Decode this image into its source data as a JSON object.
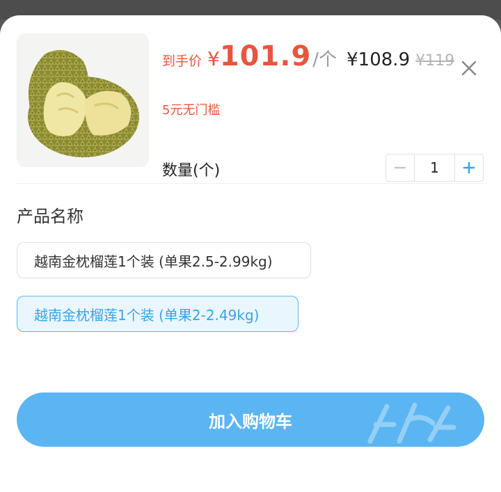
{
  "product": {
    "image_icon": "durian-image",
    "price_label": "到手价",
    "currency": "¥",
    "final_price": "101.9",
    "unit": "/个",
    "price": "¥108.9",
    "original_price": "¥119",
    "coupon": "5元无门槛"
  },
  "quantity": {
    "label": "数量(个)",
    "value": "1",
    "minus_icon": "minus-icon",
    "plus_icon": "plus-icon"
  },
  "options": {
    "title": "产品名称",
    "items": [
      {
        "label": "越南金枕榴莲1个装 (单果2.5-2.99kg)",
        "selected": false
      },
      {
        "label": "越南金枕榴莲1个装 (单果2-2.49kg)",
        "selected": true
      }
    ]
  },
  "actions": {
    "add_to_cart": "加入购物车",
    "close_icon": "close-icon"
  },
  "colors": {
    "accent_red": "#e8553f",
    "accent_blue": "#5bb5f2",
    "selected_bg": "#e9f6fd"
  }
}
